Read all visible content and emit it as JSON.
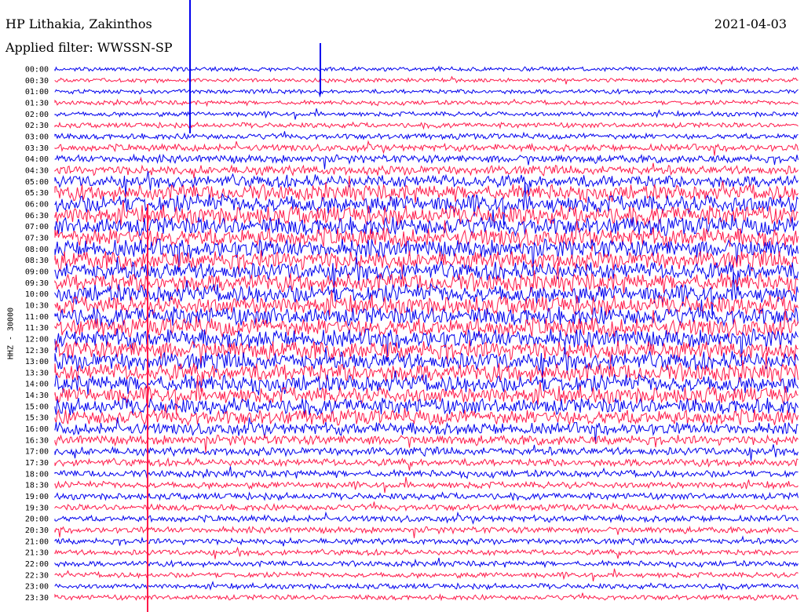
{
  "header": {
    "station": "HP Lithakia, Zakinthos",
    "date": "2021-04-03",
    "filter": "Applied filter: WWSSN-SP"
  },
  "chart_data": {
    "type": "helicorder",
    "title": "HP Lithakia, Zakinthos",
    "date": "2021-04-03",
    "filter": "WWSSN-SP",
    "ylabel": "HHZ - 30000",
    "row_labels": [
      "00:00",
      "00:30",
      "01:00",
      "01:30",
      "02:00",
      "02:30",
      "03:00",
      "03:30",
      "04:00",
      "04:30",
      "05:00",
      "05:30",
      "06:00",
      "06:30",
      "07:00",
      "07:30",
      "08:00",
      "08:30",
      "09:00",
      "09:30",
      "10:00",
      "10:30",
      "11:00",
      "11:30",
      "12:00",
      "12:30",
      "13:00",
      "13:30",
      "14:00",
      "14:30",
      "15:00",
      "15:30",
      "16:00",
      "16:30",
      "17:00",
      "17:30",
      "18:00",
      "18:30",
      "19:00",
      "19:30",
      "20:00",
      "20:30",
      "21:00",
      "21:30",
      "22:00",
      "22:30",
      "23:00",
      "23:30"
    ],
    "row_interval_minutes": 30,
    "trace_colors": [
      "#0000ee",
      "#ff1a4a"
    ],
    "grid": false,
    "activity_level": [
      0.12,
      0.12,
      0.14,
      0.14,
      0.16,
      0.18,
      0.22,
      0.28,
      0.34,
      0.45,
      0.65,
      0.85,
      1.0,
      1.0,
      1.0,
      1.0,
      1.0,
      1.0,
      1.0,
      1.0,
      1.0,
      1.0,
      1.0,
      1.0,
      1.0,
      1.0,
      1.0,
      1.0,
      0.95,
      0.9,
      0.85,
      0.8,
      0.6,
      0.45,
      0.38,
      0.33,
      0.3,
      0.28,
      0.27,
      0.26,
      0.25,
      0.24,
      0.23,
      0.22,
      0.21,
      0.2,
      0.19,
      0.18
    ]
  }
}
